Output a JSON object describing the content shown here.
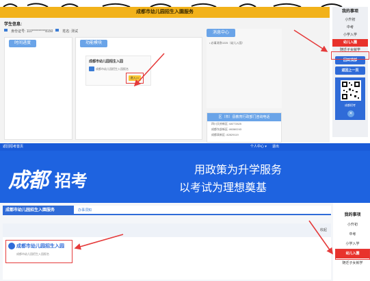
{
  "top": {
    "header_title": "成都市幼儿园招生入園服务",
    "student_info_label": "学生信息:",
    "id_label": "身份证号: 110**********8150",
    "name_label": "姓名: 测试",
    "left_pill": "时间进度",
    "center_pill": "功能模块",
    "card_title": "成都市幼儿园招生入园",
    "card_sub": "成都市幼儿园招生入园报名",
    "card_button": "进入>>",
    "msg_title": "消息中心",
    "msg_item": "• 必填消息0225（幼儿入園）",
    "phone_title": "区（市）县教育行政部门咨询电话",
    "phone_lines": [
      "四川天府新区: 68772825",
      "成都东部新区: 86360243",
      "成都高新区: 82829119"
    ],
    "sidebar": {
      "heading": "我的事项",
      "items": [
        "小升初",
        "中考",
        "小学入学",
        "幼儿入園",
        "随迁子女就学"
      ],
      "active": "幼儿入園",
      "buttons": [
        "回到顶部",
        "返回上一页"
      ],
      "qr_label": "成都招考",
      "close": "✕"
    }
  },
  "bottom": {
    "nav_home": "返回招考首页",
    "nav_user": "个人中心 ▾",
    "nav_logout": "退出",
    "logo_cheng_du": "成都",
    "logo_zhao_kao": "招考",
    "slogan1": "用政策为升学服务",
    "slogan2": "以考试为理想奠基",
    "bar_title": "成都市幼儿园招生入園服务",
    "bar_tab": "办事须知",
    "notice": "收起",
    "item_title": "成都市幼儿园招生入园",
    "item_sub": "成都市幼儿园招生入园报名",
    "sidebar": {
      "heading": "我的事项",
      "items": [
        "小升初",
        "中考",
        "小学入学",
        "幼儿入園",
        "随迁子女就学"
      ],
      "active": "幼儿入園"
    }
  },
  "colors": {
    "accent_blue": "#1e63e0",
    "highlight_red": "#e8322c",
    "header_yellow": "#f2b21a"
  }
}
